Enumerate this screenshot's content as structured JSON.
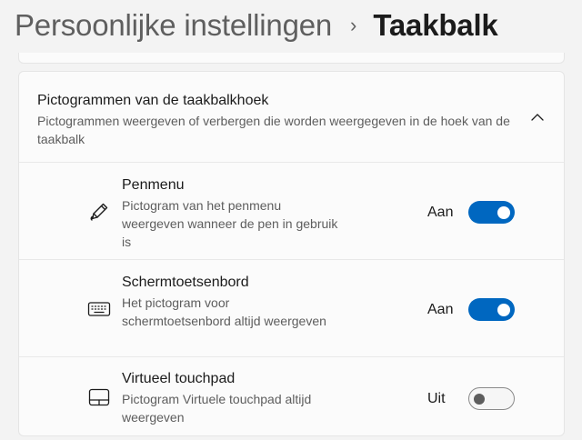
{
  "breadcrumb": {
    "parent": "Persoonlijke instellingen",
    "separator": "›",
    "current": "Taakbalk"
  },
  "section": {
    "title": "Pictogrammen van de taakbalkhoek",
    "description": "Pictogrammen weergeven of verbergen die worden weergegeven in de hoek van de taakbalk",
    "expanded": true,
    "chevron_icon": "chevron-up-icon"
  },
  "items": [
    {
      "title": "Penmenu",
      "description": "Pictogram van het penmenu weergeven wanneer de pen in gebruik is",
      "state_label": "Aan",
      "on": true,
      "icon": "pen-icon"
    },
    {
      "title": "Schermtoetsenbord",
      "description": "Het pictogram voor schermtoetsenbord altijd weergeven",
      "state_label": "Aan",
      "on": true,
      "icon": "keyboard-icon"
    },
    {
      "title": "Virtueel touchpad",
      "description": "Pictogram Virtuele touchpad altijd weergeven",
      "state_label": "Uit",
      "on": false,
      "icon": "touchpad-icon"
    }
  ],
  "colors": {
    "accent": "#0067c0",
    "background": "#f3f3f3",
    "card": "#fbfbfb"
  }
}
